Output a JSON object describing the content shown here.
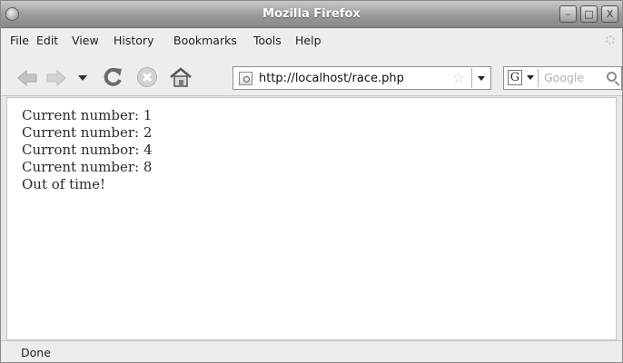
{
  "window": {
    "title": "Mozilla Firefox",
    "controls": {
      "minimize": "–",
      "maximize": "□",
      "close": "X"
    }
  },
  "menubar": {
    "items": [
      "File",
      "Edit",
      "View",
      "History",
      "Bookmarks",
      "Tools",
      "Help"
    ]
  },
  "navbar": {
    "url": "http://localhost/race.php",
    "search_engine_letter": "G",
    "search_placeholder": "Google",
    "icons": [
      "back-icon",
      "forward-icon",
      "history-dropdown-icon",
      "reload-icon",
      "stop-icon",
      "home-icon",
      "site-identity-icon",
      "bookmark-star-icon",
      "url-dropdown-icon",
      "search-engine-icon",
      "search-magnifier-icon"
    ]
  },
  "content": {
    "lines": [
      "Current number: 1",
      "Current number: 2",
      "Curront numbor: 4",
      "Current number: 8",
      "Out of time!"
    ]
  },
  "statusbar": {
    "text": "Done"
  },
  "colors": {
    "titlebar": "#9a9a9a",
    "chrome": "#eeedeb",
    "content_bg": "#ffffff",
    "text": "#2b2b2b"
  }
}
